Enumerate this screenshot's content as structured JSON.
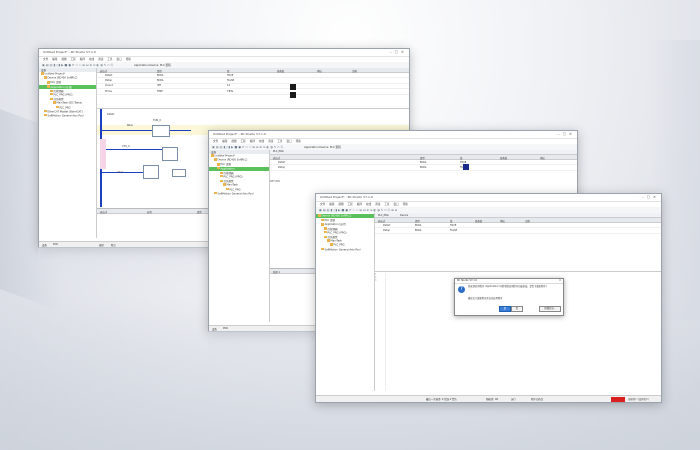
{
  "window1": {
    "title": "Untitled Project* - RC Studio V7.1.0",
    "menu": [
      "文件",
      "编辑",
      "视图",
      "工程",
      "编译",
      "在线",
      "调试",
      "工具",
      "窗口",
      "帮助"
    ],
    "app_title": "Application.Device: PLC 逻辑",
    "tree_header": "设备",
    "tree": [
      "Untitled Project*",
      "Device (RC400 SoftPLC)",
      "PLC 逻辑",
      "Application (在线)",
      "库管理器",
      "PLC_PRG (PRG)",
      "任务配置",
      "MainTask (IEC-Tasks)",
      "PLC_PRG",
      "EtherCAT Master (EtherCAT)",
      "SoftMotion General Axis Pool"
    ],
    "grid_headers": [
      "表达式",
      "类型",
      "值",
      "准备值",
      "地址",
      "注释"
    ],
    "grid_rows": [
      {
        "expr": "bStart",
        "type": "BOOL",
        "value": "TRUE"
      },
      {
        "expr": "bStop",
        "type": "BOOL",
        "value": "FALSE"
      },
      {
        "expr": "iCount",
        "type": "INT",
        "value": "12"
      },
      {
        "expr": "tTime",
        "type": "TIME",
        "value": "T#5s"
      }
    ],
    "ladder_labels": [
      "bStart",
      "bRun",
      "TON_0",
      "CTU_0",
      "xOut"
    ],
    "bottom_headers": [
      "表达式",
      "应用",
      "类型",
      "值",
      "准备值"
    ],
    "status_tabs": [
      "设备",
      "POU"
    ],
    "status_tabs2": [
      "编译",
      "断点"
    ]
  },
  "window2": {
    "title": "Untitled Project* - RC Studio V7.1.0",
    "menu": [
      "文件",
      "编辑",
      "视图",
      "工程",
      "编译",
      "在线",
      "调试",
      "工具",
      "窗口",
      "帮助"
    ],
    "app_title": "Application.Device: PLC 逻辑",
    "tree_header": "设备",
    "tree": [
      "Untitled Project*",
      "Device (RC400 SoftPLC)",
      "PLC 逻辑",
      "Application",
      "库管理器",
      "PLC_PRG (PRG)",
      "任务配置",
      "MainTask",
      "PLC_PRG",
      "SoftMotion General Axis Pool"
    ],
    "tab": "PLC_PRG",
    "grid_headers": [
      "表达式",
      "类型",
      "值",
      "准备值",
      "地址"
    ],
    "grid_rows": [
      {
        "expr": "bStart",
        "type": "BOOL",
        "value": "TRUE"
      },
      {
        "expr": "bStop",
        "type": "BOOL",
        "value": "FALSE"
      }
    ],
    "lower_header": "监视 1",
    "status_tabs": [
      "设备",
      "POU"
    ]
  },
  "window3": {
    "title": "Untitled Project* - RC Studio V7.1.0",
    "menu": [
      "文件",
      "编辑",
      "视图",
      "工程",
      "编译",
      "在线",
      "调试",
      "工具",
      "窗口",
      "帮助"
    ],
    "tree": [
      "Device (RC400 SoftPLC)",
      "PLC 逻辑",
      "Application (运行)",
      "库管理器",
      "PLC_PRG (PRG)",
      "任务配置",
      "MainTask",
      "PLC_PRG",
      "SoftMotion General Axis Pool"
    ],
    "tabs": [
      "PLC_PRG",
      "Device"
    ],
    "grid_headers": [
      "表达式",
      "类型",
      "值",
      "准备值",
      "地址",
      "注释"
    ],
    "grid_rows": [
      {
        "expr": "bStart",
        "type": "BOOL",
        "value": "TRUE"
      },
      {
        "expr": "bStop",
        "type": "BOOL",
        "value": "FALSE"
      }
    ],
    "status_items": [
      "最后一次编译: 0 错误 0 警告",
      "预编译: OK",
      "运行",
      "程序已修改",
      "当前用户: (没有用户)"
    ],
    "dialog": {
      "title": "RC Studio V7.1.0",
      "message": "登录到应用程序 'Application' 时检测到应用程序已被修改，是否下载新程序？",
      "note": "确定后下载新程序并启动应用程序",
      "ok": "是",
      "cancel": "否",
      "details": "详细信息..."
    }
  },
  "colors": {
    "tree_selected": "#59c05a",
    "status_red": "#d91f1f",
    "ladder_wire": "#1a3fbf"
  }
}
